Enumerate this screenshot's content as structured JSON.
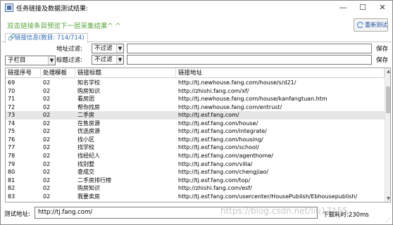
{
  "window": {
    "title": "任务链接及数据测试结果:",
    "controls": {
      "minimize": "—",
      "maximize": "☐",
      "close": "✕"
    }
  },
  "hint": {
    "text": "双击链接条目预览下一层采集结果^ ^",
    "color": "#5aa53c"
  },
  "toolbar": {
    "refresh_label": "重新测试",
    "refresh_icon": "refresh-icon"
  },
  "tab": {
    "label": "链接信息(数目: 714/714)",
    "icon": "link-icon"
  },
  "filters": {
    "column_select": "子栏目",
    "url_filter_label": "地址过滤:",
    "url_filter_mode": "不过滤",
    "title_filter_label": "标题过滤:",
    "title_filter_mode": "不过滤",
    "save_label": "保存"
  },
  "table": {
    "columns": [
      "链接序号",
      "处理模板",
      "链接标题",
      "链接地址"
    ],
    "selected_index": 4,
    "rows": [
      [
        "69",
        "02",
        "知名学校",
        "http://tj.newhouse.fang.com/house/s/d21/"
      ],
      [
        "70",
        "02",
        "购房知识",
        "http://zhishi.fang.com/xf/"
      ],
      [
        "71",
        "02",
        "看房团",
        "http://tj.newhouse.fang.com/house/kanfangtuan.htm"
      ],
      [
        "72",
        "02",
        "帮你找房",
        "http://tj.newhouse.fang.com/entrust/"
      ],
      [
        "73",
        "02",
        "二手房",
        "http://tj.esf.fang.com/"
      ],
      [
        "74",
        "02",
        "在售房源",
        "http://tj.esf.fang.com/house/"
      ],
      [
        "75",
        "02",
        "优选房源",
        "http://tj.esf.fang.com/integrate/"
      ],
      [
        "76",
        "02",
        "找小区",
        "http://tj.esf.fang.com/housing/"
      ],
      [
        "77",
        "02",
        "找学校",
        "http://tj.esf.fang.com/school/"
      ],
      [
        "78",
        "02",
        "找经纪人",
        "http://tj.esf.fang.com/agenthome/"
      ],
      [
        "79",
        "02",
        "找别墅",
        "http://tj.esf.fang.com/villa/"
      ],
      [
        "80",
        "02",
        "查成交",
        "http://tj.esf.fang.com/chengjiao/"
      ],
      [
        "81",
        "02",
        "二手房排行榜",
        "http://tj.esf.fang.com/top/"
      ],
      [
        "82",
        "02",
        "购房知识",
        "http://zhishi.fang.com/esf/"
      ],
      [
        "83",
        "02",
        "我要卖房",
        "http://tj.esf.fang.com/usercenter/HousePublish/Ebhousepublish/"
      ]
    ]
  },
  "footer": {
    "test_url_label": "测试地址:",
    "test_url_value": "http://tj.fang.com/",
    "time_label": "下载耗时:230ms",
    "watermark": "https://blog.csdn.net/liu17155"
  }
}
